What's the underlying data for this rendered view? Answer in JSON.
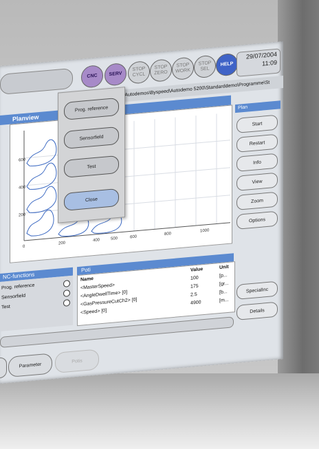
{
  "header": {
    "buttons": [
      {
        "label": "CNC",
        "style": "purple"
      },
      {
        "label": "SERV",
        "style": "purple"
      },
      {
        "label": "STOP CYCL",
        "style": "gray"
      },
      {
        "label": "STOP ZERO",
        "style": "gray"
      },
      {
        "label": "STOP WORK",
        "style": "gray"
      },
      {
        "label": "STOP SEL",
        "style": "gray"
      },
      {
        "label": "HELP",
        "style": "blue"
      }
    ],
    "date": "29/07/2004",
    "time": "11:09"
  },
  "path": "gie\\Autodemos\\Byspeed\\Autodemo 5200\\Standarddemo\\Programme\\St",
  "planview": {
    "title": "Planview",
    "y_ticks": [
      "600",
      "400",
      "200"
    ],
    "x_ticks": [
      "0",
      "200",
      "400",
      "500",
      "600",
      "800",
      "1000"
    ]
  },
  "popup": {
    "buttons": [
      "Prog. reference",
      "Sensorfield",
      "Test",
      "Close"
    ]
  },
  "sidebar": {
    "title": "Plan",
    "buttons": [
      "Start",
      "Restart",
      "Info",
      "View",
      "Zoom",
      "Options",
      "SpecialInc",
      "Details"
    ]
  },
  "nc_functions": {
    "title": "NC-functions",
    "items": [
      "Prog. reference",
      "Sensorfield",
      "Test"
    ]
  },
  "poti": {
    "title": "Poti",
    "columns": [
      "Name",
      "Value",
      "Unit"
    ],
    "rows": [
      {
        "name": "<MasterSpeed>",
        "value": "100",
        "unit": "[p..."
      },
      {
        "name": "<AngleDwellTime> [0]",
        "value": "175",
        "unit": "[gr..."
      },
      {
        "name": "<GasPressureCutCh2> [0]",
        "value": "2.5",
        "unit": "[b..."
      },
      {
        "name": "<Speed> [0]",
        "value": "4900",
        "unit": "[m..."
      }
    ]
  },
  "bottom_tabs": [
    {
      "label": "Parameter",
      "enabled": true
    },
    {
      "label": "Potis",
      "enabled": false
    }
  ],
  "colors": {
    "accent": "#5b8ad0",
    "purple": "#a78ac8",
    "help": "#3f63c7"
  }
}
